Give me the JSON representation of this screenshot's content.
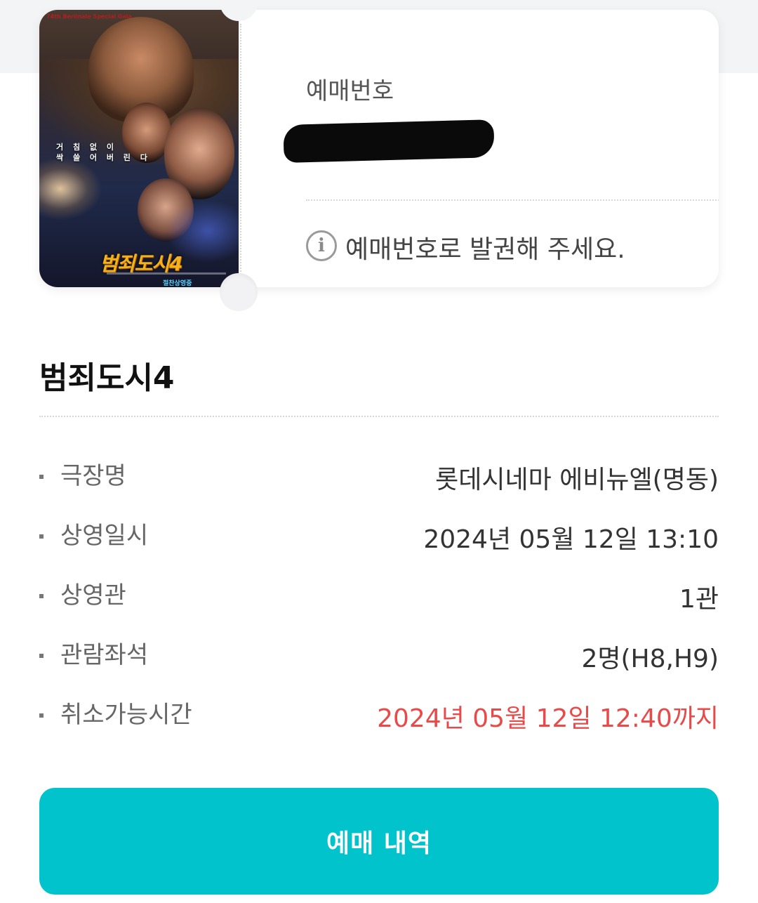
{
  "ticket": {
    "booking_label": "예매번호",
    "notice": "예매번호로 발권해 주세요.",
    "poster": {
      "tagline_line1": "거 침 없 이",
      "tagline_line2": "싹 쓸 어 버 린 다",
      "logo_text": "범죄도시4",
      "badge": "74th Berlinale Special Gala",
      "release_text": "절찬상영중"
    }
  },
  "movie": {
    "title": "범죄도시4"
  },
  "details": [
    {
      "label": "극장명",
      "value": "롯데시네마 에비뉴엘(명동)"
    },
    {
      "label": "상영일시",
      "value": "2024년 05월 12일 13:10"
    },
    {
      "label": "상영관",
      "value": "1관"
    },
    {
      "label": "관람좌석",
      "value": "2명(H8,H9)"
    },
    {
      "label": "취소가능시간",
      "value": "2024년 05월 12일 12:40까지"
    }
  ],
  "actions": {
    "history_button": "예매 내역"
  },
  "colors": {
    "accent": "#00c3cc",
    "warning": "#e84a4a"
  }
}
